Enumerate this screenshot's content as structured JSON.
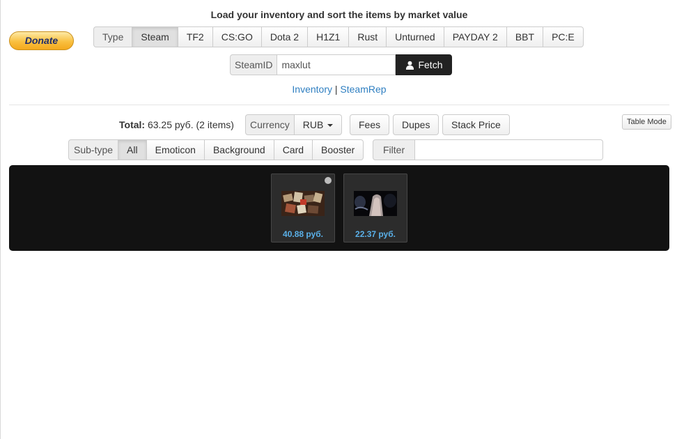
{
  "header": {
    "title": "Load your inventory and sort the items by market value",
    "donate_label": "Donate"
  },
  "game_tabs": {
    "label": "Type",
    "items": [
      "Steam",
      "TF2",
      "CS:GO",
      "Dota 2",
      "H1Z1",
      "Rust",
      "Unturned",
      "PAYDAY 2",
      "BBT",
      "PC:E"
    ],
    "active": "Steam"
  },
  "steamid": {
    "label": "SteamID",
    "value": "maxlut",
    "fetch_label": "Fetch"
  },
  "links": {
    "inventory": "Inventory",
    "separator": "|",
    "steamrep": "SteamRep"
  },
  "summary": {
    "total_label": "Total:",
    "total_value": "63.25 руб. (2 items)",
    "currency_label": "Currency",
    "currency_value": "RUB",
    "fees": "Fees",
    "dupes": "Dupes",
    "stack_price": "Stack Price",
    "table_mode": "Table Mode"
  },
  "subtype": {
    "label": "Sub-type",
    "items": [
      "All",
      "Emoticon",
      "Background",
      "Card",
      "Booster"
    ],
    "active": "All"
  },
  "filter": {
    "label": "Filter",
    "value": ""
  },
  "items": [
    {
      "price": "40.88 руб.",
      "selected": true
    },
    {
      "price": "22.37 руб.",
      "selected": false
    }
  ],
  "colors": {
    "link": "#2f7fc1",
    "price": "#5ab0e8",
    "inventory_bg": "#121212",
    "fetch_bg": "#222222"
  }
}
